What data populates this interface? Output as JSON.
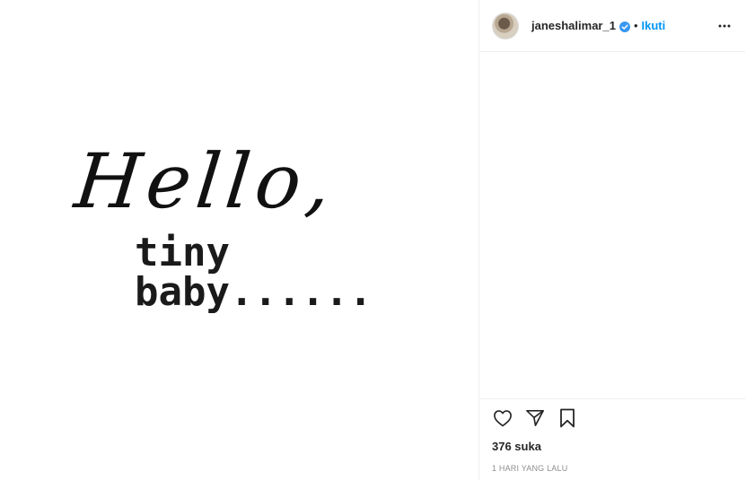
{
  "media": {
    "line1": "Hello,",
    "line2": "tiny baby......"
  },
  "header": {
    "username": "janeshalimar_1",
    "separator": "•",
    "follow_label": "Ikuti",
    "verified_icon": "verified-badge-icon",
    "more_icon": "more-options-icon"
  },
  "actions": {
    "like_icon": "heart-icon",
    "share_icon": "paper-plane-icon",
    "save_icon": "bookmark-icon"
  },
  "stats": {
    "likes": "376 suka",
    "posted": "1 HARI YANG LALU"
  },
  "colors": {
    "accent": "#0095f6",
    "text": "#262626",
    "muted": "#8e8e8e",
    "border": "#efefef"
  }
}
